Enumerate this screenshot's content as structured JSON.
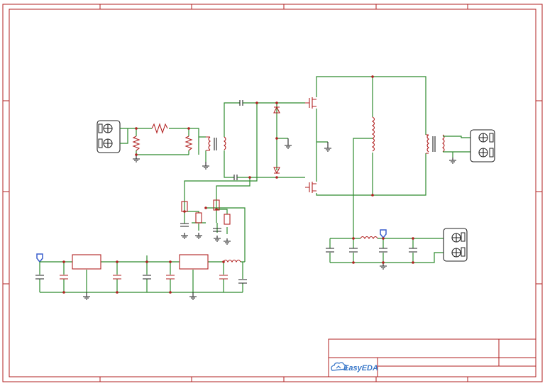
{
  "title_block": {
    "logo_text": "EasyEDA"
  },
  "colors": {
    "wire": "#2e8b2e",
    "component": "#b22222",
    "border": "#b22222",
    "logo": "#3a78c9"
  }
}
